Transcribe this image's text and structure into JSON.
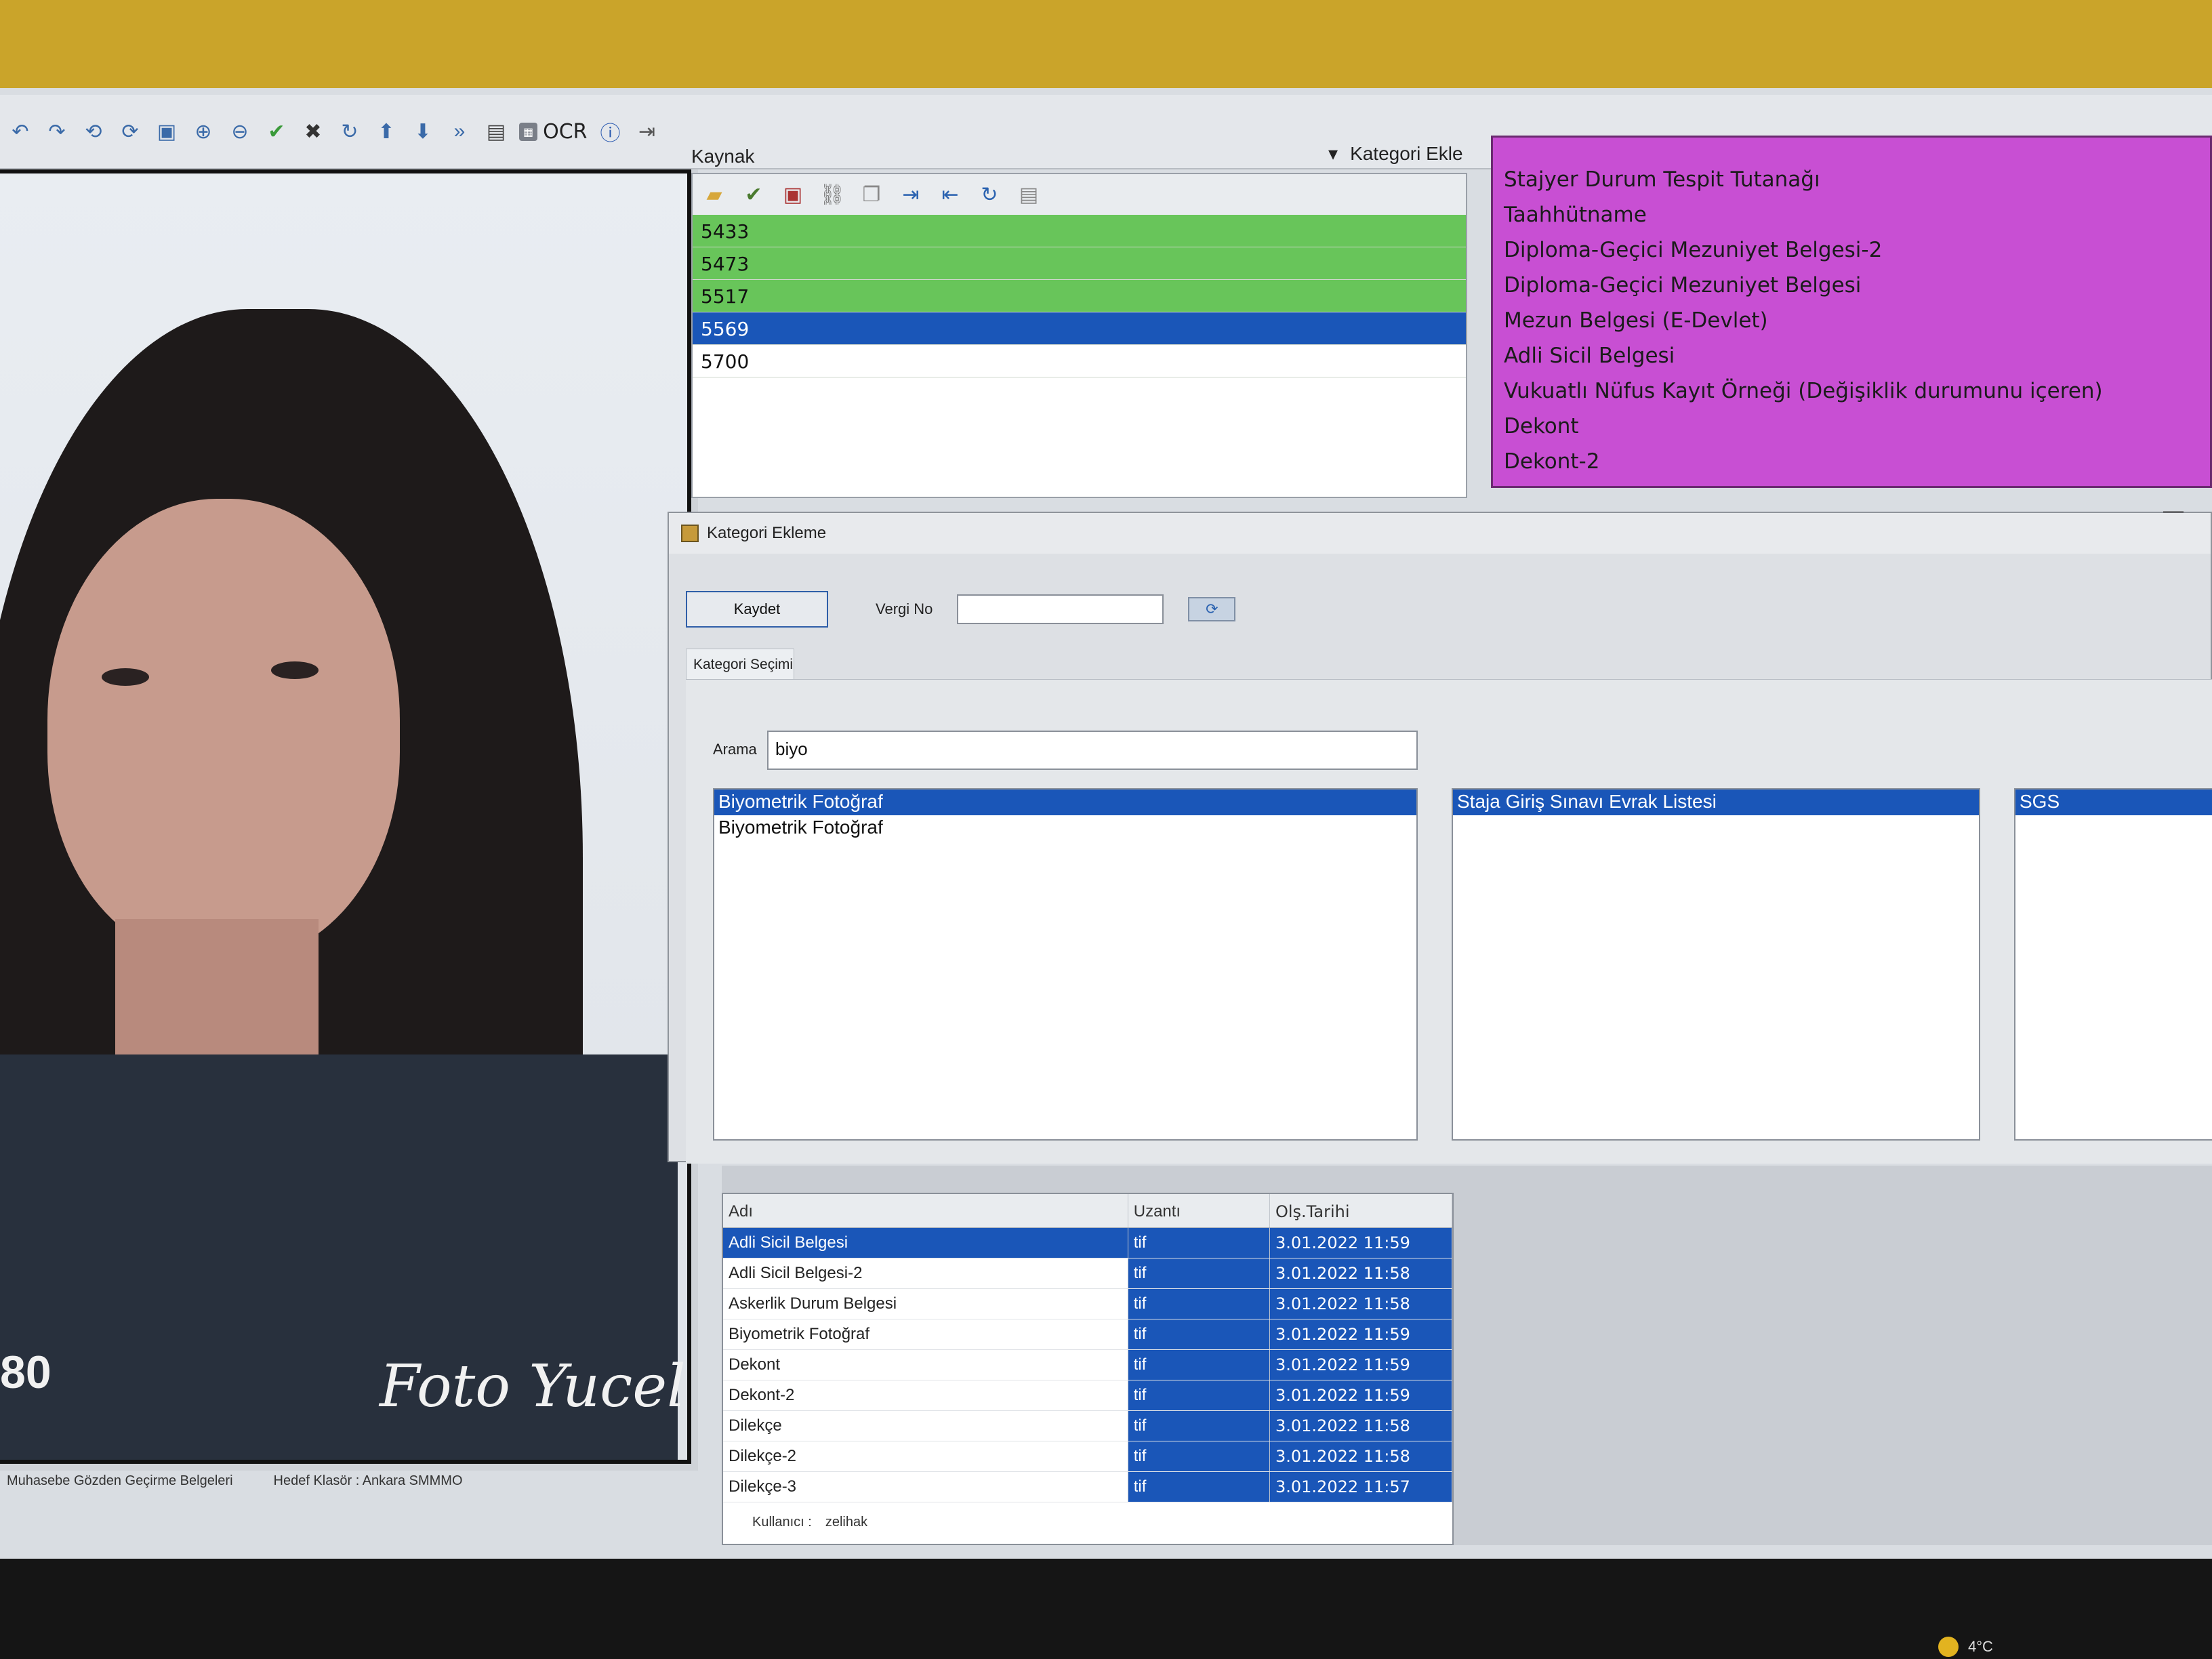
{
  "toolbar": {
    "ocr_label": "OCR"
  },
  "viewer": {
    "photo_number": "80",
    "watermark": "Foto Yucel"
  },
  "status_left": {
    "path_label": "Muhasebe Gözden Geçirme Belgeleri",
    "target_label": "Hedef Klasör : Ankara SMMMO"
  },
  "source": {
    "label": "Kaynak",
    "items": [
      {
        "value": "5433",
        "state": "green"
      },
      {
        "value": "5473",
        "state": "green"
      },
      {
        "value": "5517",
        "state": "green"
      },
      {
        "value": "5569",
        "state": "selected"
      },
      {
        "value": "5700",
        "state": "plain"
      }
    ]
  },
  "kategori_ekle_label": "Kategori Ekle",
  "categories": [
    "Stajyer Durum Tespit Tutanağı",
    "Taahhütname",
    "Diploma-Geçici Mezuniyet Belgesi-2",
    "Diploma-Geçici Mezuniyet Belgesi",
    "Mezun Belgesi (E-Devlet)",
    "Adli Sicil Belgesi",
    "Vukuatlı Nüfus Kayıt Örneği (Değişiklik durumunu içeren)",
    "Dekont",
    "Dekont-2"
  ],
  "dialog": {
    "title": "Kategori Ekleme",
    "save_label": "Kaydet",
    "vergi_label": "Vergi No",
    "vergi_value": "",
    "tab_label": "Kategori Seçimi",
    "search_label": "Arama",
    "search_value": "biyo",
    "results": [
      {
        "label": "Biyometrik Fotoğraf",
        "selected": true
      },
      {
        "label": "Biyometrik Fotoğraf",
        "selected": false
      }
    ],
    "middle_list": [
      {
        "label": "Staja Giriş Sınavı Evrak Listesi",
        "selected": true
      }
    ],
    "right_list": [
      {
        "label": "SGS",
        "selected": true
      }
    ]
  },
  "grid": {
    "headers": {
      "name": "Adı",
      "ext": "Uzantı",
      "date": "Olş.Tarihi"
    },
    "rows": [
      {
        "name": "Adli Sicil Belgesi",
        "ext": "tif",
        "date": "3.01.2022 11:59",
        "selected": true
      },
      {
        "name": "Adli Sicil Belgesi-2",
        "ext": "tif",
        "date": "3.01.2022 11:58"
      },
      {
        "name": "Askerlik Durum Belgesi",
        "ext": "tif",
        "date": "3.01.2022 11:58"
      },
      {
        "name": "Biyometrik Fotoğraf",
        "ext": "tif",
        "date": "3.01.2022 11:59"
      },
      {
        "name": "Dekont",
        "ext": "tif",
        "date": "3.01.2022 11:59"
      },
      {
        "name": "Dekont-2",
        "ext": "tif",
        "date": "3.01.2022 11:59"
      },
      {
        "name": "Dilekçe",
        "ext": "tif",
        "date": "3.01.2022 11:58"
      },
      {
        "name": "Dilekçe-2",
        "ext": "tif",
        "date": "3.01.2022 11:58"
      },
      {
        "name": "Dilekçe-3",
        "ext": "tif",
        "date": "3.01.2022 11:57"
      }
    ]
  },
  "status_right": {
    "user_label": "Kullanıcı :",
    "user_value": "zelihak"
  },
  "tray": {
    "temperature": "4°C"
  }
}
